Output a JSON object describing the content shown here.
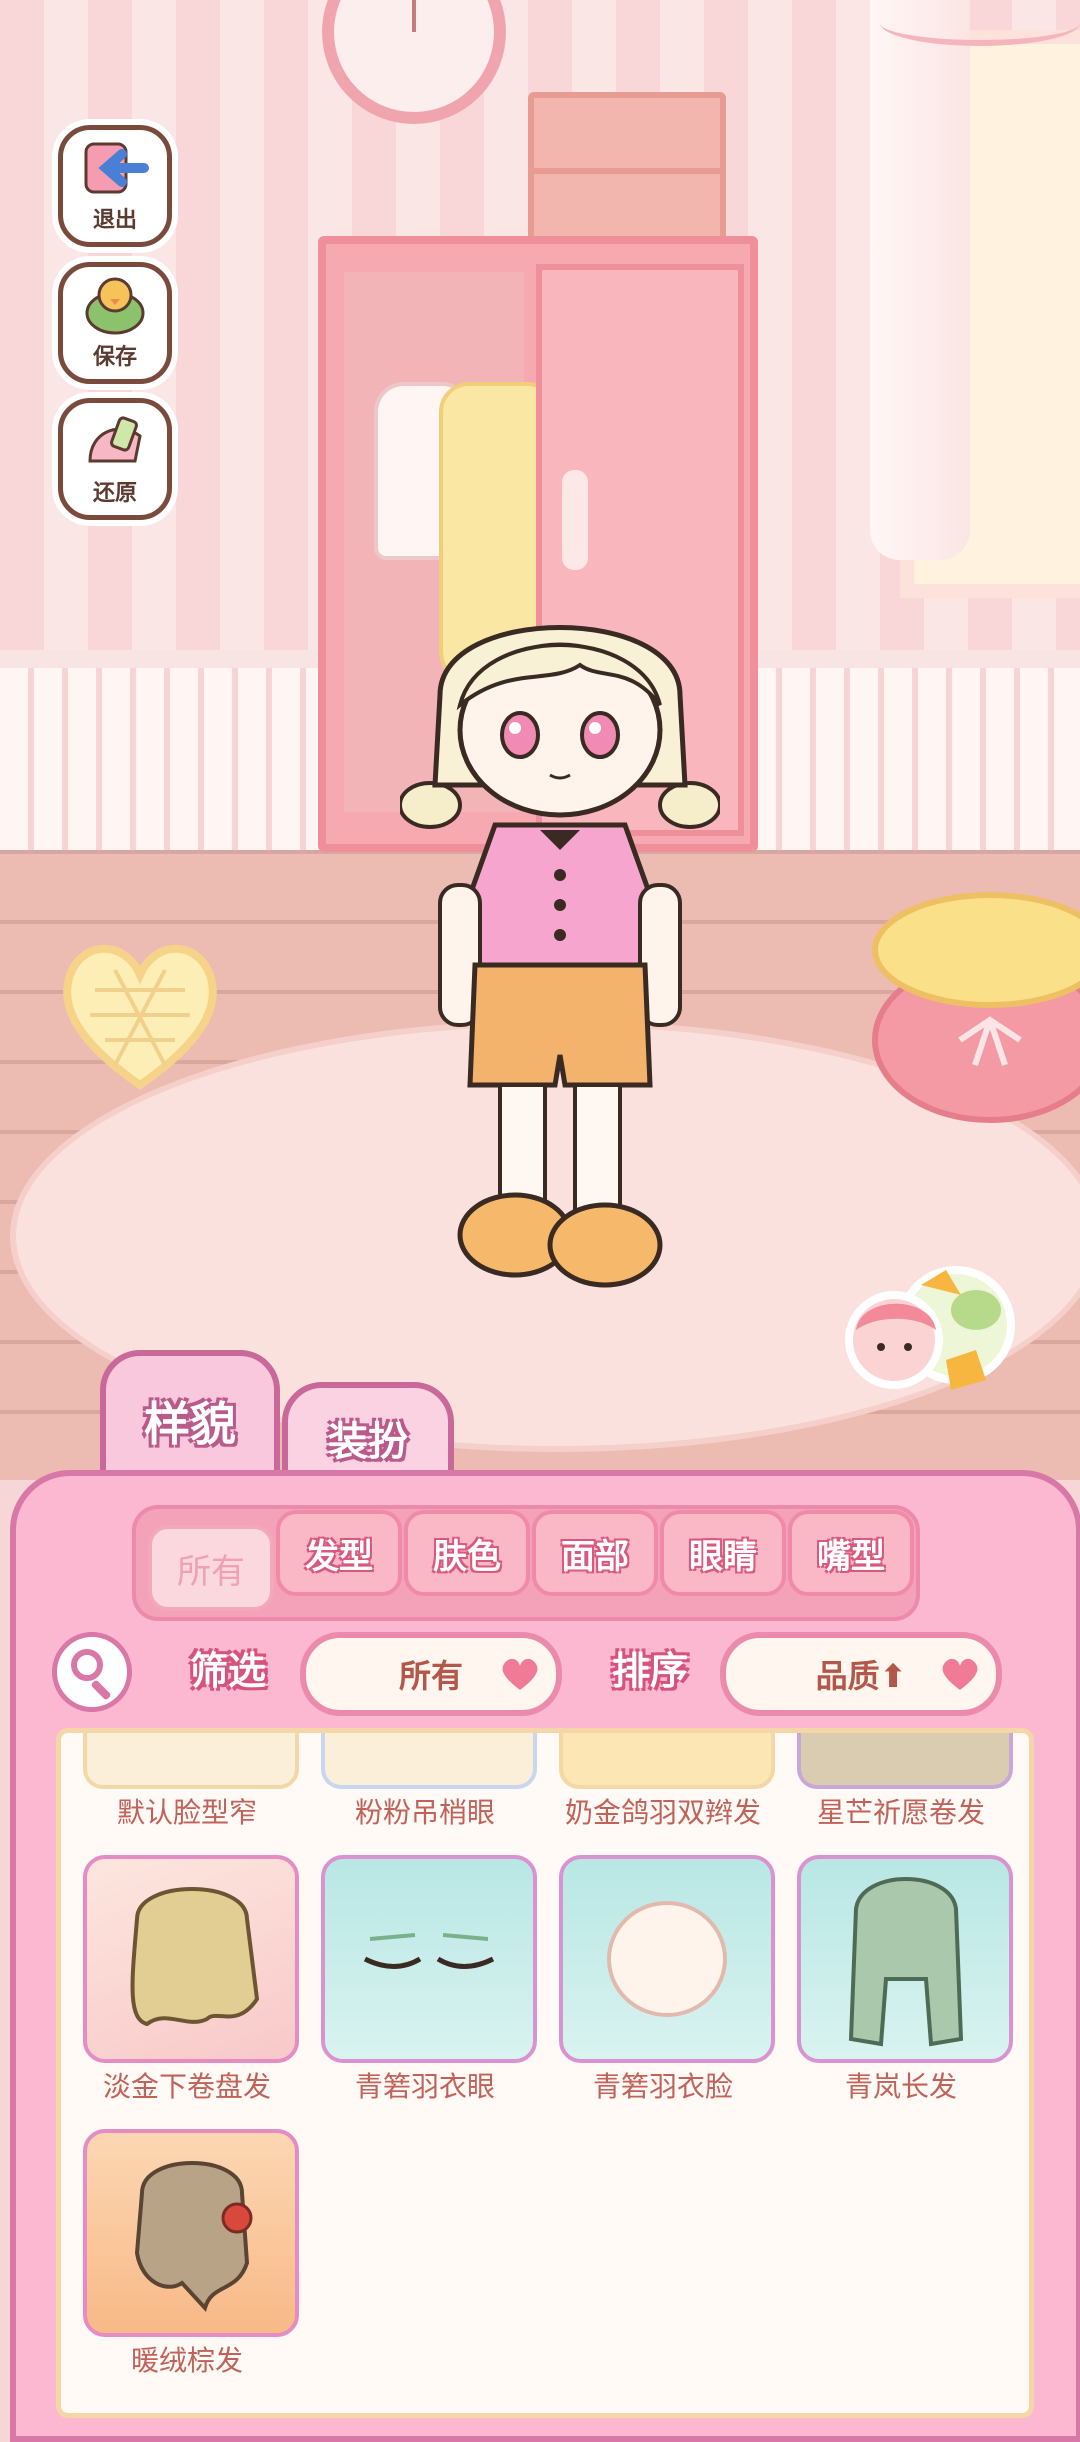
{
  "side_buttons": [
    {
      "label": "退出",
      "icon": "exit-arrow-icon"
    },
    {
      "label": "保存",
      "icon": "save-duck-icon"
    },
    {
      "label": "还原",
      "icon": "restore-icon"
    }
  ],
  "category_tabs": [
    {
      "label": "样貌",
      "active": true
    },
    {
      "label": "装扮",
      "active": false
    }
  ],
  "sub_tabs": [
    {
      "label": "所有",
      "active": true
    },
    {
      "label": "发型",
      "active": false
    },
    {
      "label": "肤色",
      "active": false
    },
    {
      "label": "面部",
      "active": false
    },
    {
      "label": "眼睛",
      "active": false
    },
    {
      "label": "嘴型",
      "active": false
    }
  ],
  "filter": {
    "label": "筛选",
    "value": "所有"
  },
  "sort": {
    "label": "排序",
    "value": "品质⬆"
  },
  "items_partial_row": [
    {
      "name": "默认脸型窄"
    },
    {
      "name": "粉粉吊梢眼"
    },
    {
      "name": "奶金鸽羽双辫发"
    },
    {
      "name": "星芒祈愿卷发"
    }
  ],
  "items": [
    {
      "name": "淡金下卷盘发",
      "thumb": "hair-light-gold"
    },
    {
      "name": "青箬羽衣眼",
      "thumb": "eyes-closed"
    },
    {
      "name": "青箬羽衣脸",
      "thumb": "face-base"
    },
    {
      "name": "青岚长发",
      "thumb": "hair-teal-long"
    },
    {
      "name": "暖绒棕发",
      "thumb": "hair-brown-earmuff"
    }
  ],
  "colors": {
    "panel": "#fbb8d0",
    "accent": "#d878a7",
    "label_text": "#c0625a"
  }
}
